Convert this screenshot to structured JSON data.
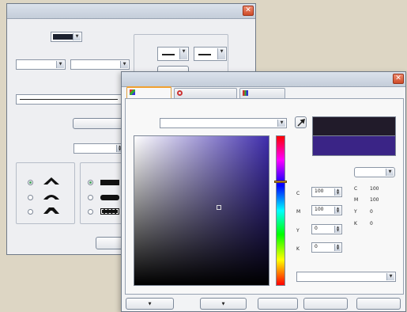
{
  "colors": {
    "current_swatch": "#211b2a",
    "new_swatch": "#3a2486",
    "picker_hue": "#3f2dac",
    "line_color_swatch": "#1d2230"
  },
  "outline_dialog": {
    "title": "",
    "color_label": "",
    "width_label": "",
    "width_value": "",
    "unit_value": "",
    "style_label": "",
    "edit_style_button": "",
    "arrows_label": "",
    "miter_label": "",
    "miter_value": "",
    "corners_label": "",
    "line_caps_label": "",
    "ok_button": ""
  },
  "color_dialog": {
    "title": "",
    "tabs": [
      {
        "label": "",
        "icon": "models-icon"
      },
      {
        "label": "",
        "icon": "mixers-icon"
      },
      {
        "label": "",
        "icon": "palettes-icon"
      }
    ],
    "active_tab": 0,
    "model_label": "",
    "model_value": "",
    "eyedropper_icon": "eyedropper-icon",
    "model_select": "",
    "fields": [
      {
        "label": "C",
        "value": "100"
      },
      {
        "label": "M",
        "value": "100"
      },
      {
        "label": "Y",
        "value": "0"
      },
      {
        "label": "K",
        "value": "0"
      }
    ],
    "readouts": [
      {
        "label": "C",
        "value": "100"
      },
      {
        "label": "M",
        "value": "100"
      },
      {
        "label": "Y",
        "value": "0"
      },
      {
        "label": "K",
        "value": "0"
      }
    ],
    "name_label": "",
    "name_value": "",
    "buttons": {
      "add_to_palette": "",
      "options": "",
      "ok": "",
      "cancel": "",
      "help": ""
    }
  }
}
